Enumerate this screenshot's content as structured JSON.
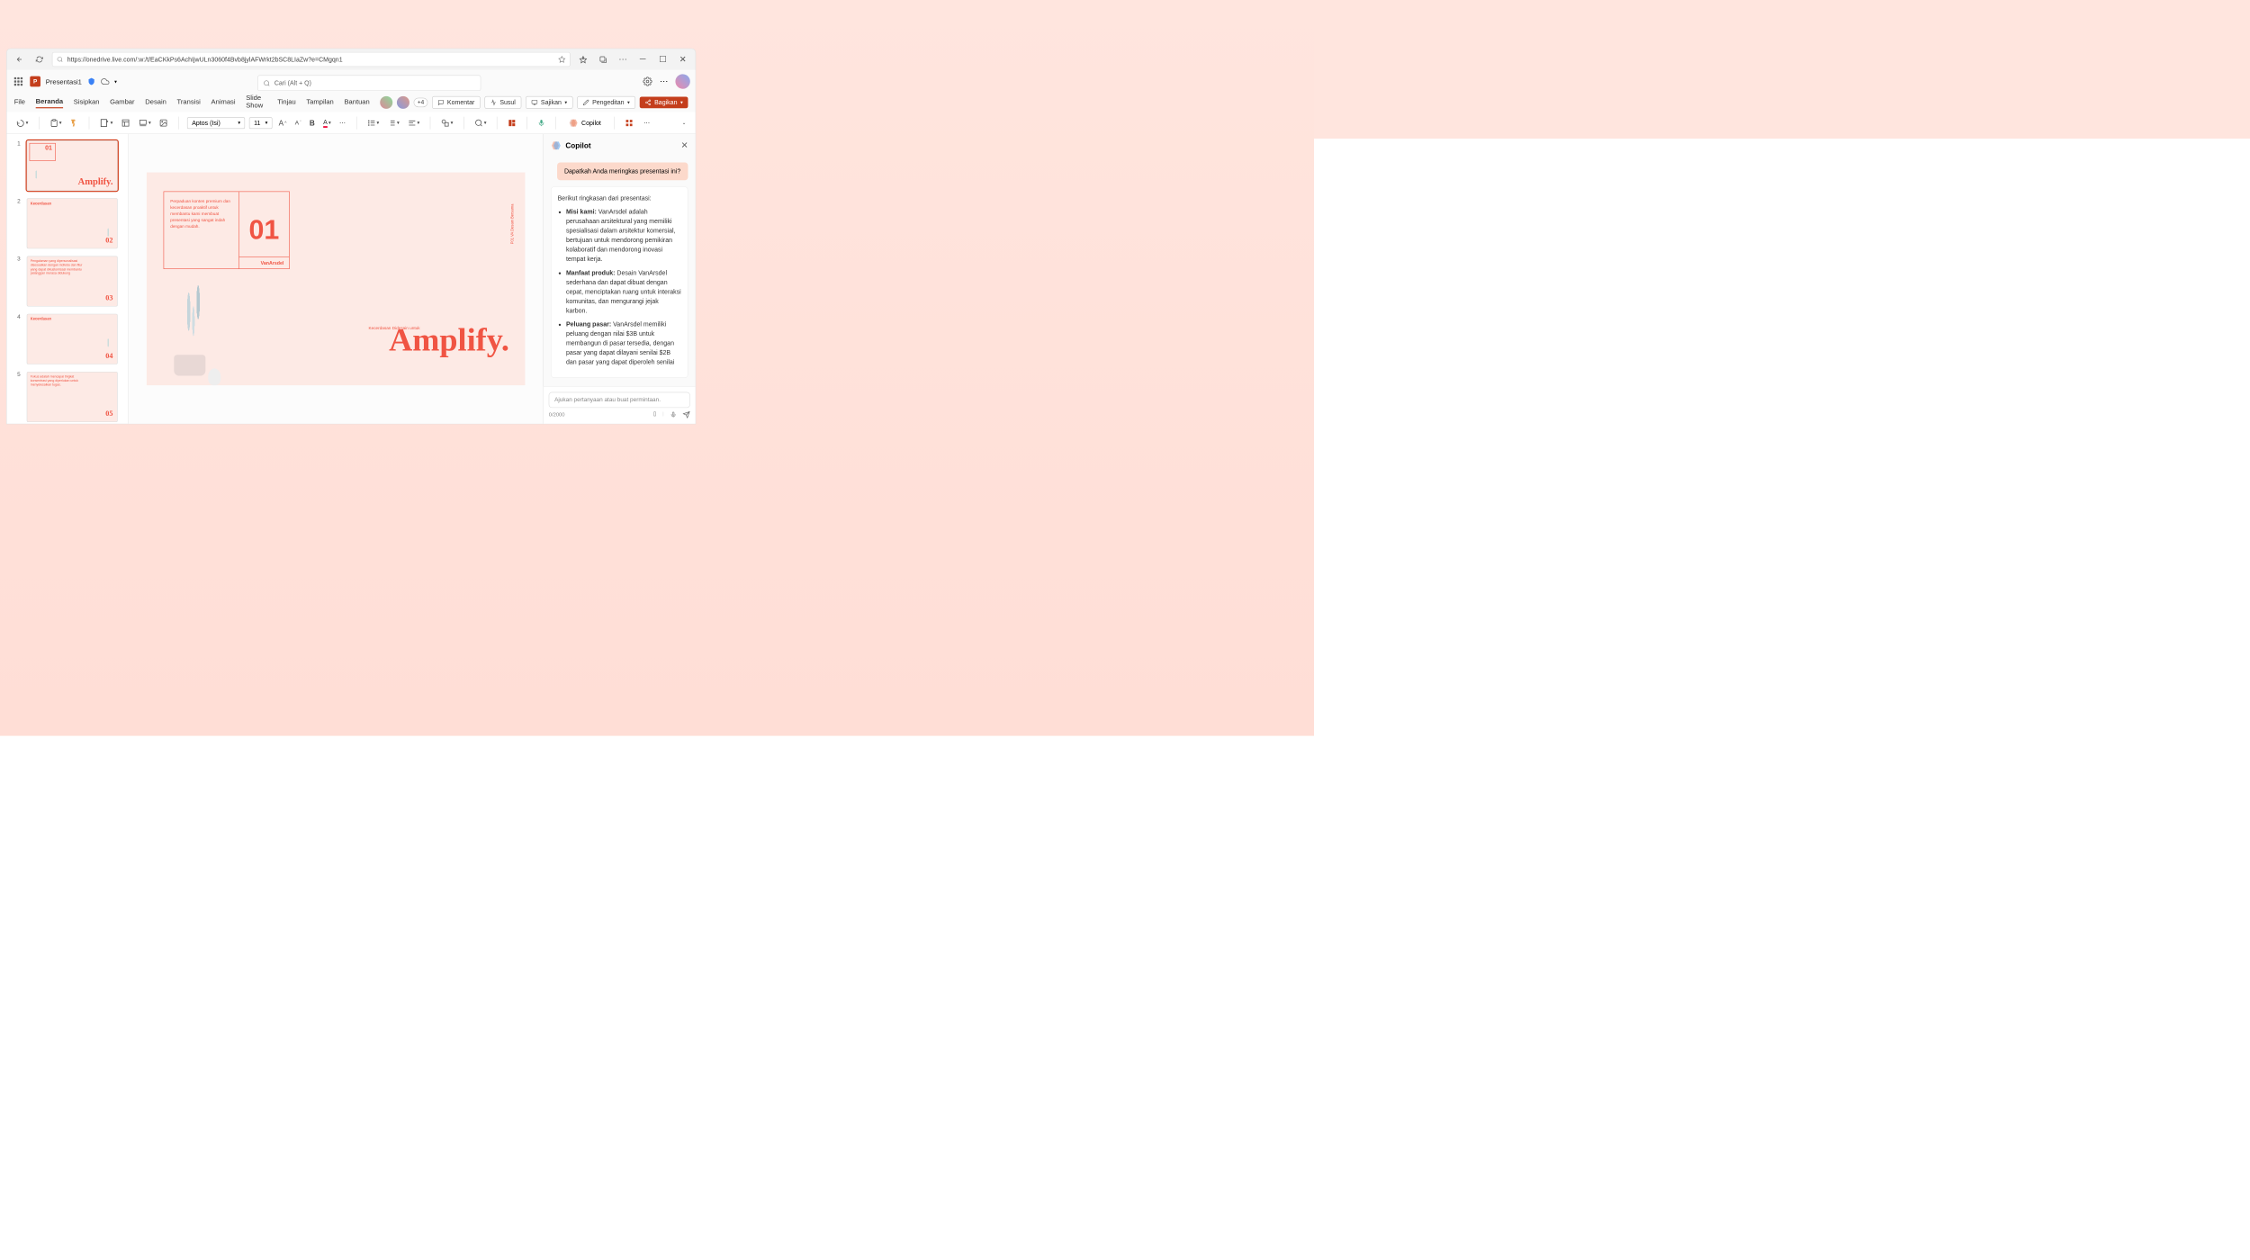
{
  "url": "https://onedrive.live.com/:w:/t/EaCKkPs6AchIjwULn3060f4Bvb8jylAFWrkt2bSC8LIaZw?e=CMgqn1",
  "docTitle": "Presentasi1",
  "searchPlaceholder": "Cari (Alt + Q)",
  "menus": {
    "file": "File",
    "beranda": "Beranda",
    "sisipkan": "Sisipkan",
    "gambar": "Gambar",
    "desain": "Desain",
    "transisi": "Transisi",
    "animasi": "Animasi",
    "slideshow": "Slide Show",
    "tinjau": "Tinjau",
    "tampilan": "Tampilan",
    "bantuan": "Bantuan"
  },
  "actions": {
    "komentar": "Komentar",
    "susul": "Susul",
    "sajikan": "Sajikan",
    "pengeditan": "Pengeditan",
    "bagikan": "Bagikan",
    "plusN": "+4"
  },
  "ribbon": {
    "font": "Aptos (Isi)",
    "size": "11",
    "copilot": "Copilot"
  },
  "slide": {
    "boxText": "Perpaduan konten premium dan kecerdasan proaktif untuk membantu kami membuat presentasi yang sangat indah dengan mudah.",
    "num": "01",
    "brand": "VanArsdel",
    "subtitle": "Kecerdasan Didesain untuk",
    "amplify": "Amplify.",
    "sideText": "P01   VA Desain Bersama"
  },
  "thumbs": {
    "t1": {
      "amp": "Amplify.",
      "n": "01"
    },
    "t2": {
      "title": "Kecerdasan",
      "n": "02"
    },
    "t3": {
      "text": "Pengalaman yang dipersonalisasi disesuaikan dengan individu dan fitur yang dapat dikustomisasi membantu pelanggan merasa didukung",
      "n": "03"
    },
    "t4": {
      "title": "Kecerdasan",
      "n": "04"
    },
    "t5": {
      "text": "Fokus adalah mencapai tingkat konsentrasi yang diperlukan untuk menyelesaikan tugas.",
      "n": "05"
    }
  },
  "copilot": {
    "title": "Copilot",
    "userMsg": "Dapatkah Anda meringkas presentasi ini?",
    "intro": "Berikut ringkasan dari presentasi:",
    "b1label": "Misi kami:",
    "b1": " VanArsdel adalah perusahaan arsitektural yang memiliki spesialisasi dalam arsitektur komersial, bertujuan untuk mendorong pemikiran kolaboratif dan mendorong inovasi tempat kerja.",
    "b2label": "Manfaat produk:",
    "b2": " Desain VanArsdel sederhana dan dapat dibuat dengan cepat, menciptakan ruang untuk interaksi komunitas, dan mengurangi jejak karbon.",
    "b3label": "Peluang pasar:",
    "b3": " VanArsdel memiliki peluang dengan nilai $3B untuk membangun di pasar tersedia, dengan pasar yang dapat dilayani senilai $2B dan pasar yang dapat diperoleh senilai",
    "placeholder": "Ajukan pertanyaan atau buat permintaan.",
    "counter": "0/2000"
  }
}
